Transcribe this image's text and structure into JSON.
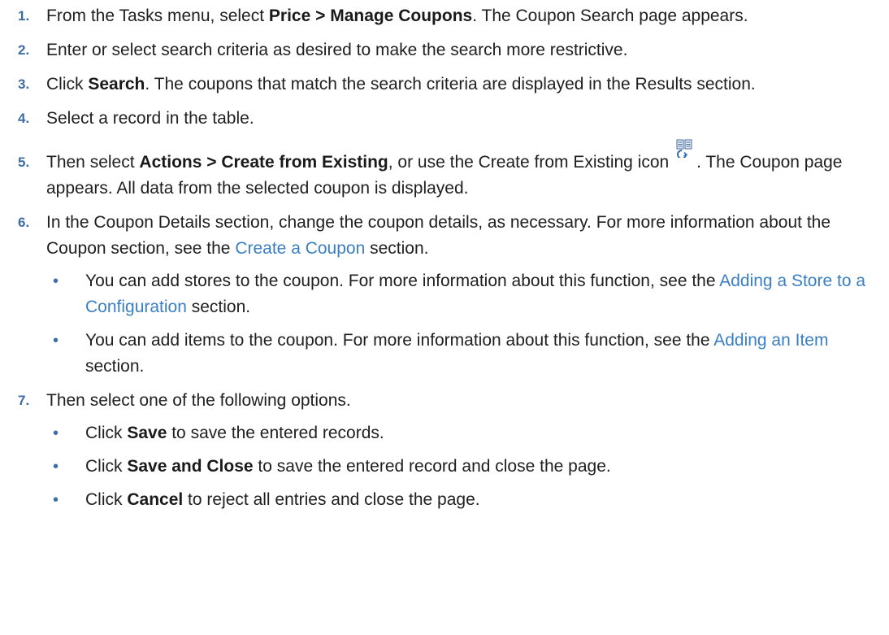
{
  "steps": [
    {
      "num": "1.",
      "parts": {
        "a": "From the Tasks menu, select ",
        "b": "Price > Manage Coupons",
        "c": ". The Coupon Search page appears."
      }
    },
    {
      "num": "2.",
      "parts": {
        "a": "Enter or select search criteria as desired to make the search more restrictive."
      }
    },
    {
      "num": "3.",
      "parts": {
        "a": "Click ",
        "b": "Search",
        "c": ". The coupons that match the search criteria are displayed in the Results section."
      }
    },
    {
      "num": "4.",
      "parts": {
        "a": "Select a record in the table."
      }
    },
    {
      "num": "5.",
      "parts": {
        "a": "Then select ",
        "b": "Actions > Create from Existing",
        "c": ", or use the Create from Existing icon ",
        "d": ". The Coupon page appears. All data from the selected coupon is displayed."
      }
    },
    {
      "num": "6.",
      "parts": {
        "a": "In the Coupon Details section, change the coupon details, as necessary. For more information about the Coupon section, see the ",
        "link": "Create a Coupon",
        "c": " section."
      },
      "bullets": [
        {
          "a": "You can add stores to the coupon. For more information about this function, see the ",
          "link": "Adding a Store to a Configuration",
          "c": " section."
        },
        {
          "a": "You can add items to the coupon. For more information about this function, see the ",
          "link": "Adding an Item",
          "c": " section."
        }
      ]
    },
    {
      "num": "7.",
      "parts": {
        "a": "Then select one of the following options."
      },
      "bullets": [
        {
          "a": "Click ",
          "b": "Save",
          "c": " to save the entered records."
        },
        {
          "a": "Click ",
          "b": "Save and Close",
          "c": " to save the entered record and close the page."
        },
        {
          "a": "Click ",
          "b": "Cancel",
          "c": " to reject all entries and close the page."
        }
      ]
    }
  ],
  "bullet_glyph": "•",
  "icons": {
    "create_from_existing": "create-from-existing-icon"
  },
  "colors": {
    "step_number": "#3c6ea5",
    "link": "#3a7fc3",
    "text": "#202020"
  }
}
